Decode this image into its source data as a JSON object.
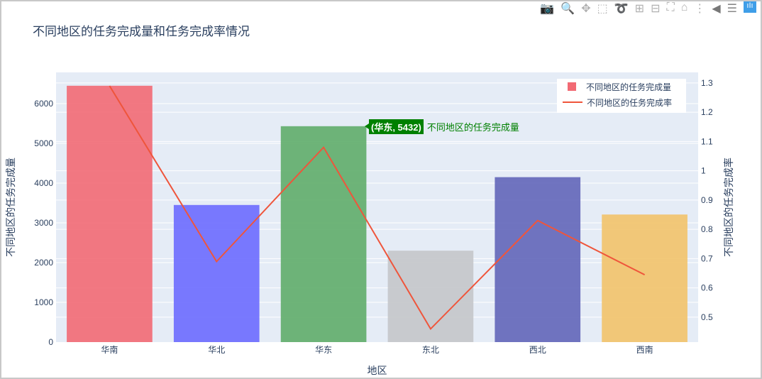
{
  "title": "不同地区的任务完成量和任务完成率情况",
  "toolbar": [
    "camera-icon",
    "zoom-icon",
    "pan-icon",
    "box-select-icon",
    "lasso-icon",
    "zoom-in-icon",
    "zoom-out-icon",
    "autoscale-icon",
    "reset-icon",
    "spike-icon",
    "hover-closest-icon",
    "hover-compare-icon",
    "plotly-logo-icon"
  ],
  "hover": {
    "label": "(华东, 5432)",
    "series": "不同地区的任务完成量"
  },
  "chart_data": {
    "type": "bar",
    "title": "不同地区的任务完成量和任务完成率情况",
    "xlabel": "地区",
    "ylabel": "不同地区的任务完成量",
    "y2label": "不同地区的任务完成率",
    "categories": [
      "华南",
      "华北",
      "华东",
      "东北",
      "西北",
      "西南"
    ],
    "ylim": [
      0,
      6786
    ],
    "y2lim": [
      0.415,
      1.336
    ],
    "yticks": [
      "0",
      "1000",
      "2000",
      "3000",
      "4000",
      "5000",
      "6000"
    ],
    "y2ticks": [
      "0.5",
      "0.6",
      "0.7",
      "0.8",
      "0.9",
      "1",
      "1.1",
      "1.2",
      "1.3"
    ],
    "series": [
      {
        "name": "不同地区的任务完成量",
        "type": "bar",
        "axis": "y",
        "values": [
          6450,
          3450,
          5432,
          2300,
          4150,
          3210
        ],
        "colors": [
          "#f26a74",
          "#6c6cff",
          "#5fad6a",
          "#c4c6ca",
          "#6266b9",
          "#f2c36a"
        ]
      },
      {
        "name": "不同地区的任务完成率",
        "type": "line",
        "axis": "y2",
        "values": [
          1.29,
          0.69,
          1.08,
          0.46,
          0.83,
          0.645
        ],
        "color": "#ef553b"
      }
    ],
    "legend": "top-right",
    "grid": true
  }
}
